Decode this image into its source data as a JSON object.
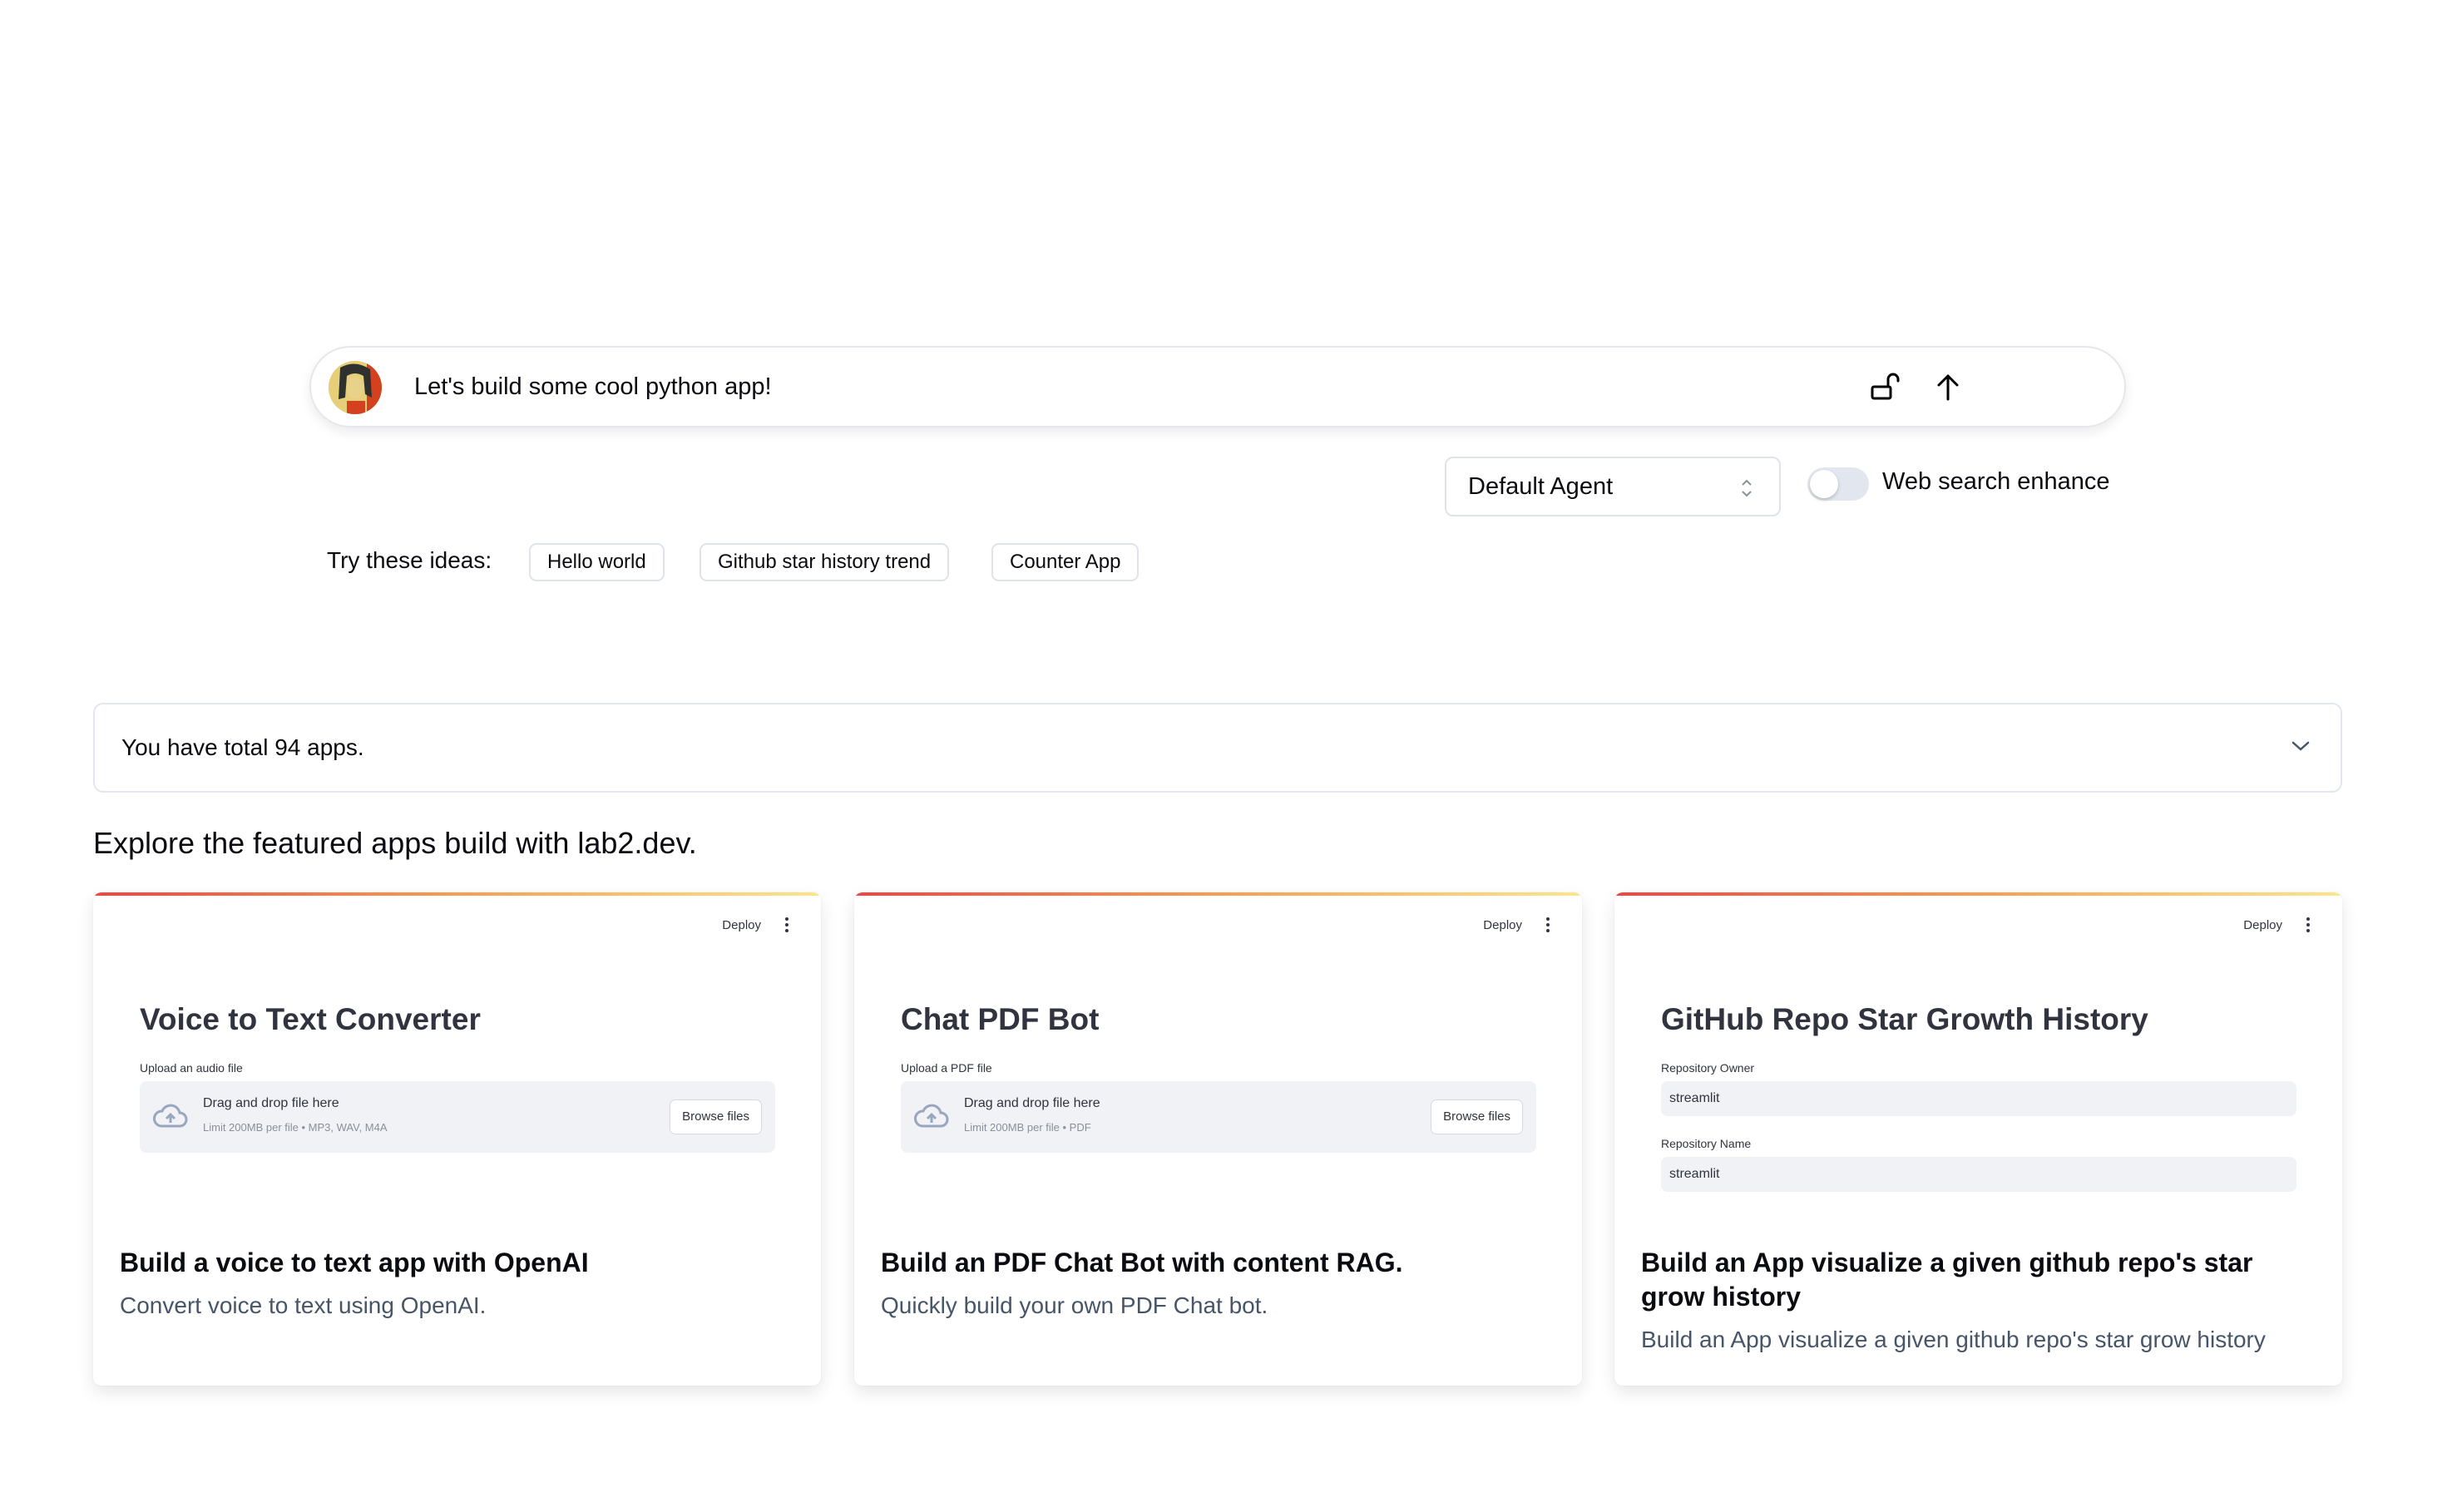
{
  "chat": {
    "input_value": "Let's build some cool python app!",
    "avatar": "user-avatar",
    "icons": [
      "unlock-icon",
      "arrow-up-icon"
    ]
  },
  "controls": {
    "agent_select_value": "Default Agent",
    "web_search_label": "Web search enhance",
    "web_search_enabled": false
  },
  "ideas": {
    "label": "Try these ideas:",
    "chips": [
      "Hello world",
      "Github star history trend",
      "Counter App"
    ]
  },
  "apps_summary": {
    "text": "You have total 94 apps."
  },
  "featured": {
    "heading": "Explore the featured apps build with lab2.dev.",
    "cards": [
      {
        "preview": {
          "deploy_label": "Deploy",
          "title": "Voice to Text Converter",
          "upload_label": "Upload an audio file",
          "dropzone_title": "Drag and drop file here",
          "dropzone_sub": "Limit 200MB per file • MP3, WAV, M4A",
          "browse_label": "Browse files"
        },
        "title": "Build a voice to text app with OpenAI",
        "description": "Convert voice to text using OpenAI."
      },
      {
        "preview": {
          "deploy_label": "Deploy",
          "title": "Chat PDF Bot",
          "upload_label": "Upload a PDF file",
          "dropzone_title": "Drag and drop file here",
          "dropzone_sub": "Limit 200MB per file • PDF",
          "browse_label": "Browse files"
        },
        "title": "Build an PDF Chat Bot with content RAG.",
        "description": "Quickly build your own PDF Chat bot."
      },
      {
        "preview": {
          "deploy_label": "Deploy",
          "title": "GitHub Repo Star Growth History",
          "owner_label": "Repository Owner",
          "owner_value": "streamlit",
          "name_label": "Repository Name",
          "name_value": "streamlit"
        },
        "title": "Build an App visualize a given github repo's star grow history",
        "description": "Build an App visualize a given github repo's star grow history"
      }
    ]
  },
  "colors": {
    "gradient_start": "#ef4444",
    "gradient_mid": "#f59e52",
    "gradient_end": "#fde68a",
    "toggle_off": "#e2e7ef",
    "preview_field_bg": "#f0f2f6"
  }
}
